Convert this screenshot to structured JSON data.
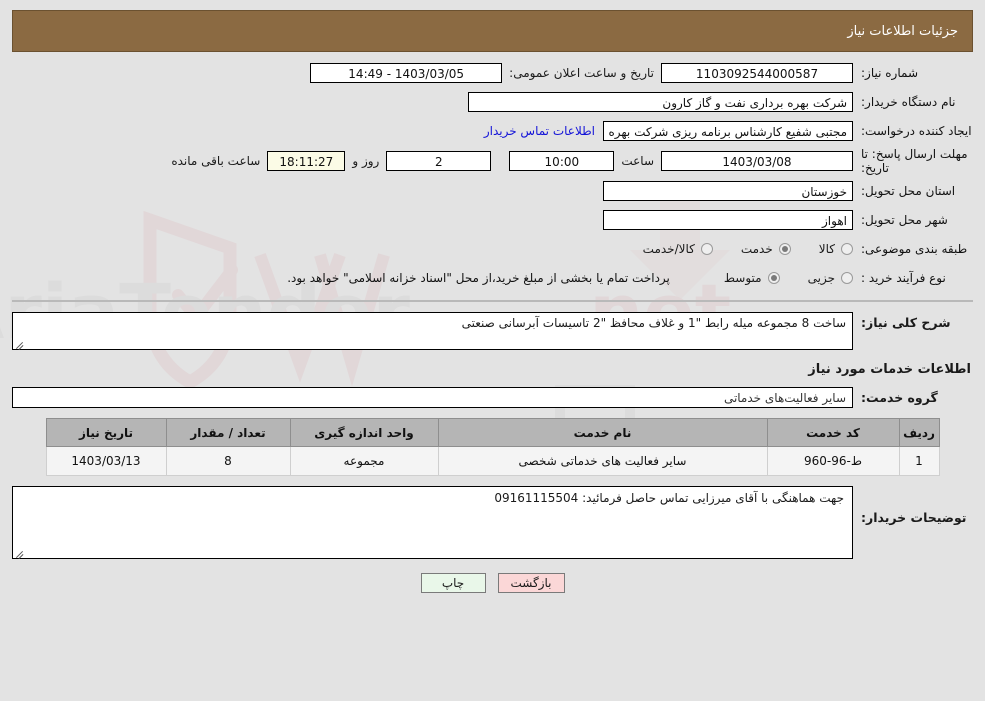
{
  "header": {
    "title": "جزئیات اطلاعات نیاز"
  },
  "form": {
    "need_number_label": "شماره نیاز:",
    "need_number_value": "1103092544000587",
    "buyer_org_label": "نام دستگاه خریدار:",
    "buyer_org_value": "شرکت بهره برداری نفت و گاز کارون",
    "creator_label": "ایجاد کننده درخواست:",
    "creator_value": "مجتبی شفیع کارشناس برنامه ریزی شرکت بهره برداری نفت و گاز کارون",
    "deadline_label": "مهلت ارسال پاسخ: تا تاریخ:",
    "deadline_date": "1403/03/08",
    "time_label": "ساعت",
    "time_value": "10:00",
    "days_value": "2",
    "days_label": "روز و",
    "remaining_value": "18:11:27",
    "remaining_label": "ساعت باقی مانده",
    "public_announce_label": "تاریخ و ساعت اعلان عمومی:",
    "public_announce_value": "1403/03/05 - 14:49",
    "contact_link": "اطلاعات تماس خریدار",
    "province_label": "استان محل تحویل:",
    "province_value": "خوزستان",
    "city_label": "شهر محل تحویل:",
    "city_value": "اهواز",
    "category_label": "طبقه بندی موضوعی:",
    "category_options": [
      {
        "label": "کالا",
        "selected": false
      },
      {
        "label": "خدمت",
        "selected": true
      },
      {
        "label": "کالا/خدمت",
        "selected": false
      }
    ],
    "purchase_label": "نوع فرآیند خرید :",
    "purchase_options": [
      {
        "label": "جزیی",
        "selected": false
      },
      {
        "label": "متوسط",
        "selected": true
      }
    ],
    "payment_note": "پرداخت تمام یا بخشی از مبلغ خرید،از محل \"اسناد خزانه اسلامی\" خواهد بود."
  },
  "description": {
    "label": "شرح کلی نیاز:",
    "value": "ساخت 8 مجموعه میله رابط \"1 و غلاف محافظ \"2 تاسیسات آبرسانی صنعتی"
  },
  "services": {
    "heading": "اطلاعات خدمات مورد نیاز",
    "group_label": "گروه خدمت:",
    "group_value": "سایر فعالیت‌های خدماتی",
    "columns": [
      "ردیف",
      "کد خدمت",
      "نام خدمت",
      "واحد اندازه گیری",
      "تعداد / مقدار",
      "تاریخ نیاز"
    ],
    "rows": [
      {
        "index": "1",
        "code": "ط-96-960",
        "name": "سایر فعالیت های خدماتی شخصی",
        "unit": "مجموعه",
        "quantity": "8",
        "date": "1403/03/13"
      }
    ]
  },
  "comments": {
    "label": "توضیحات خریدار:",
    "value": "جهت هماهنگی با آقای میرزایی تماس حاصل فرمائید: 09161115504"
  },
  "footer": {
    "print_label": "چاپ",
    "back_label": "بازگشت"
  },
  "colors": {
    "header_bg": "#8b6a42",
    "link": "#1313d8",
    "print_btn": "#e9f7e9",
    "back_btn": "#fbd7d7"
  }
}
